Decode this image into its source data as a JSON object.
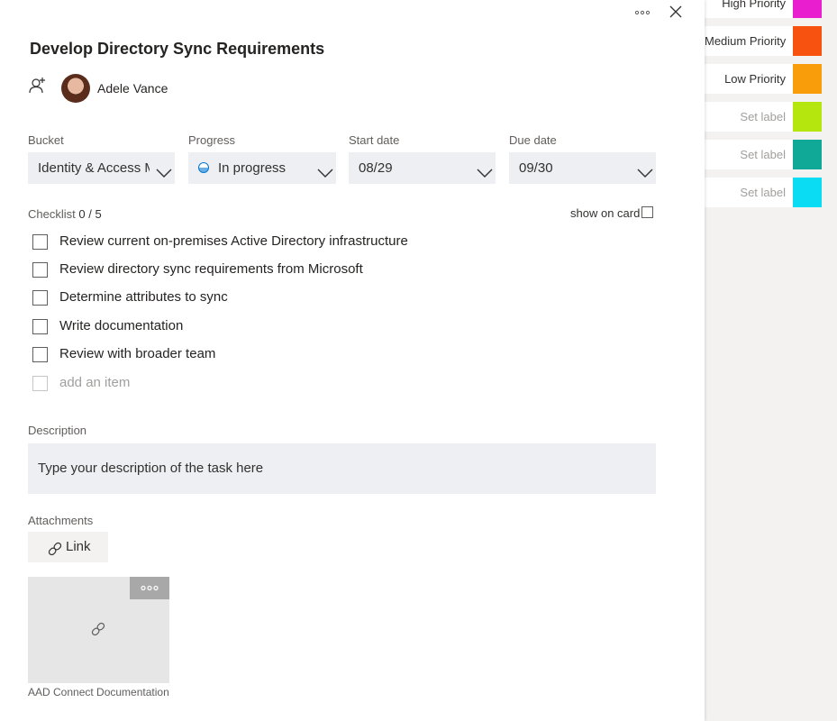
{
  "task": {
    "title": "Develop Directory Sync Requirements",
    "assignee": {
      "name": "Adele Vance"
    }
  },
  "icons": {
    "more": "more-options-icon",
    "close": "close-icon",
    "assign": "add-person-icon",
    "chevron": "chevron-down-icon",
    "progress": "half-circle-progress-icon",
    "link": "link-icon"
  },
  "fields": {
    "bucket": {
      "label": "Bucket",
      "value": "Identity & Access M"
    },
    "progress": {
      "label": "Progress",
      "value": "In progress"
    },
    "start_date": {
      "label": "Start date",
      "value": "08/29"
    },
    "due_date": {
      "label": "Due date",
      "value": "09/30"
    }
  },
  "checklist": {
    "label": "Checklist",
    "count": "0 / 5",
    "show_on_card_label": "show on card",
    "items": [
      "Review current on-premises Active Directory infrastructure",
      "Review directory sync requirements from Microsoft",
      "Determine attributes to sync",
      "Write documentation",
      "Review with broader team"
    ],
    "add_placeholder": "add an item"
  },
  "description": {
    "label": "Description",
    "placeholder": "Type your description of the task here"
  },
  "attachments": {
    "label": "Attachments",
    "link_button": "Link",
    "items": [
      {
        "name": "AAD Connect Documentation"
      }
    ]
  },
  "labels": [
    {
      "name": "High Priority",
      "color": "#e81ecf"
    },
    {
      "name": "Medium Priority",
      "color": "#f7520f"
    },
    {
      "name": "Low Priority",
      "color": "#f99d0b"
    },
    {
      "name": "Set label",
      "color": "#b5e60e"
    },
    {
      "name": "Set label",
      "color": "#10a897"
    },
    {
      "name": "Set label",
      "color": "#0adcf3"
    }
  ],
  "colors": {
    "accent": "#0078d4",
    "field_background": "#edeff3"
  }
}
